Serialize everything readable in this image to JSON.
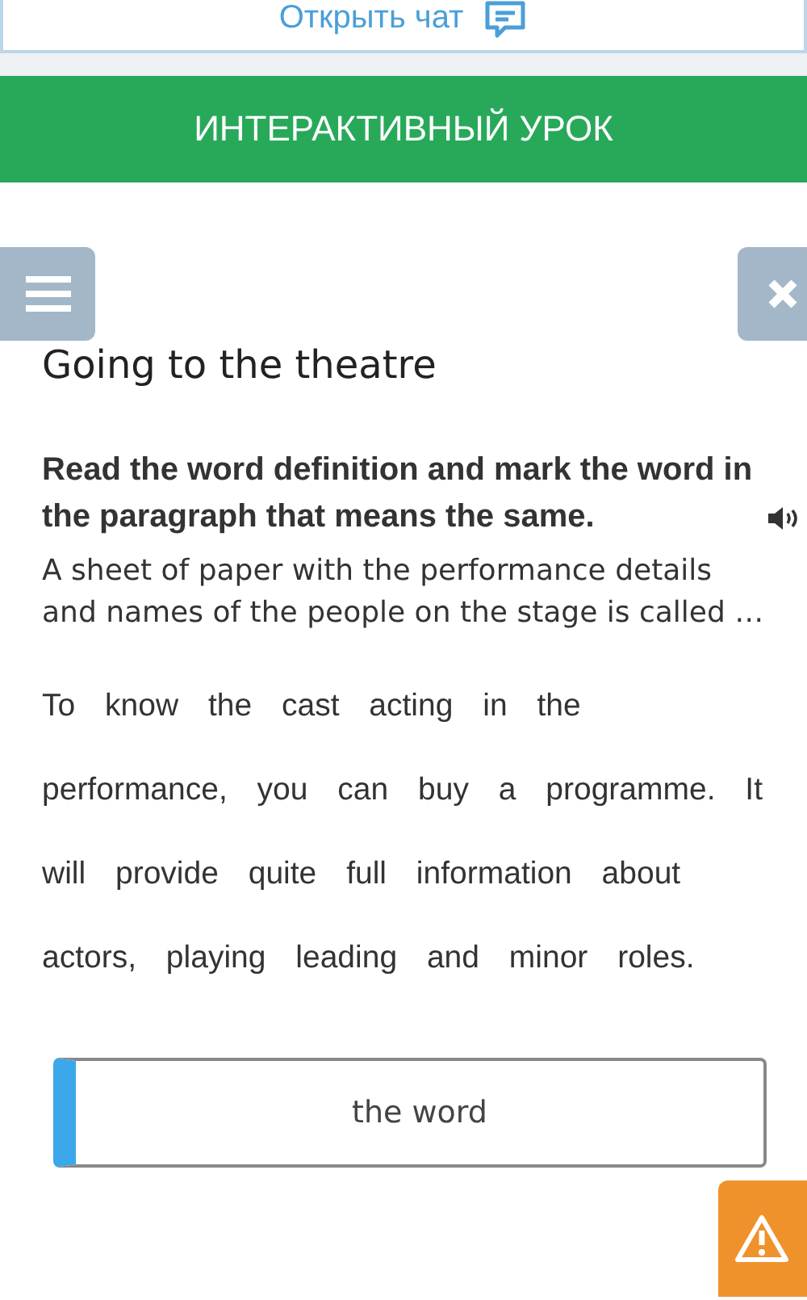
{
  "chat_button": {
    "label": "Открыть чат"
  },
  "header": {
    "title": "ИНТЕРАКТИВНЫЙ УРОК"
  },
  "lesson": {
    "title": "Going to the theatre",
    "instruction": "Read the word definition and mark the word in the paragraph that means the same.",
    "definition": "A sheet of paper with the performance details and names of the people on the stage is called …",
    "paragraph_lines": [
      "To know the cast acting in the",
      "performance, you can buy a programme. It",
      "will provide quite full information about",
      "actors, playing leading and minor roles."
    ],
    "answer": {
      "placeholder": "the word"
    }
  }
}
